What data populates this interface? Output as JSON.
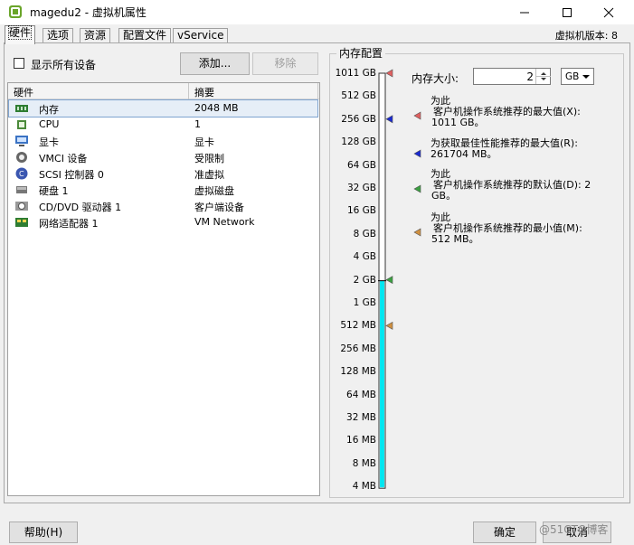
{
  "window": {
    "title": "magedu2 - 虚拟机属性",
    "version": "虚拟机版本: 8",
    "minimize_icon": "minimize-icon",
    "maximize_icon": "maximize-icon",
    "close_icon": "close-icon"
  },
  "tabs": [
    {
      "label": "硬件",
      "active": true
    },
    {
      "label": "选项",
      "active": false
    },
    {
      "label": "资源",
      "active": false
    },
    {
      "label": "配置文件",
      "active": false
    },
    {
      "label": "vService",
      "active": false
    }
  ],
  "hardware": {
    "show_all_label": "显示所有设备",
    "show_all_checked": false,
    "add_button": "添加...",
    "remove_button": "移除",
    "columns": [
      "硬件",
      "摘要"
    ],
    "rows": [
      {
        "name": "内存",
        "summary": "2048 MB",
        "icon": "memory-icon",
        "selected": true
      },
      {
        "name": "CPU",
        "summary": "1",
        "icon": "cpu-icon",
        "selected": false
      },
      {
        "name": "显卡",
        "summary": "显卡",
        "icon": "display-icon",
        "selected": false
      },
      {
        "name": "VMCI 设备",
        "summary": "受限制",
        "icon": "vmci-icon",
        "selected": false
      },
      {
        "name": "SCSI 控制器 0",
        "summary": "准虚拟",
        "icon": "scsi-icon",
        "selected": false
      },
      {
        "name": "硬盘 1",
        "summary": "虚拟磁盘",
        "icon": "disk-icon",
        "selected": false
      },
      {
        "name": "CD/DVD 驱动器 1",
        "summary": "客户端设备",
        "icon": "cdrom-icon",
        "selected": false
      },
      {
        "name": "网络适配器 1",
        "summary": "VM Network",
        "icon": "network-icon",
        "selected": false
      }
    ]
  },
  "memory": {
    "group_title": "内存配置",
    "size_label": "内存大小:",
    "size_value": "2",
    "unit_value": "GB",
    "scale_labels": [
      "1011 GB",
      "512 GB",
      "256 GB",
      "128 GB",
      "64 GB",
      "32 GB",
      "16 GB",
      "8 GB",
      "4 GB",
      "2 GB",
      "1 GB",
      "512 MB",
      "256 MB",
      "128 MB",
      "64 MB",
      "32 MB",
      "16 MB",
      "8 MB",
      "4 MB"
    ],
    "slider_fill_fraction": 0.5,
    "legend": [
      {
        "line1": "为此",
        "line2": "客户机操作系统推荐的最大值(X):",
        "line3": "1011 GB。",
        "color": "#e06060",
        "icon": "max-recommended-icon"
      },
      {
        "line1": "为获取最佳性能推荐的最大值(R):",
        "line2": "261704 MB。",
        "line3": "",
        "color": "#1a2ad0",
        "icon": "max-performance-icon"
      },
      {
        "line1": "为此",
        "line2": "客户机操作系统推荐的默认值(D): 2",
        "line3": "GB。",
        "color": "#3aa040",
        "icon": "default-recommended-icon"
      },
      {
        "line1": "为此",
        "line2": "客户机操作系统推荐的最小值(M):",
        "line3": "512 MB。",
        "color": "#d09040",
        "icon": "min-recommended-icon"
      }
    ]
  },
  "footer": {
    "help_button": "帮助(H)",
    "ok_button": "确定",
    "cancel_button": "取消",
    "watermark": "@51CTO博客"
  }
}
